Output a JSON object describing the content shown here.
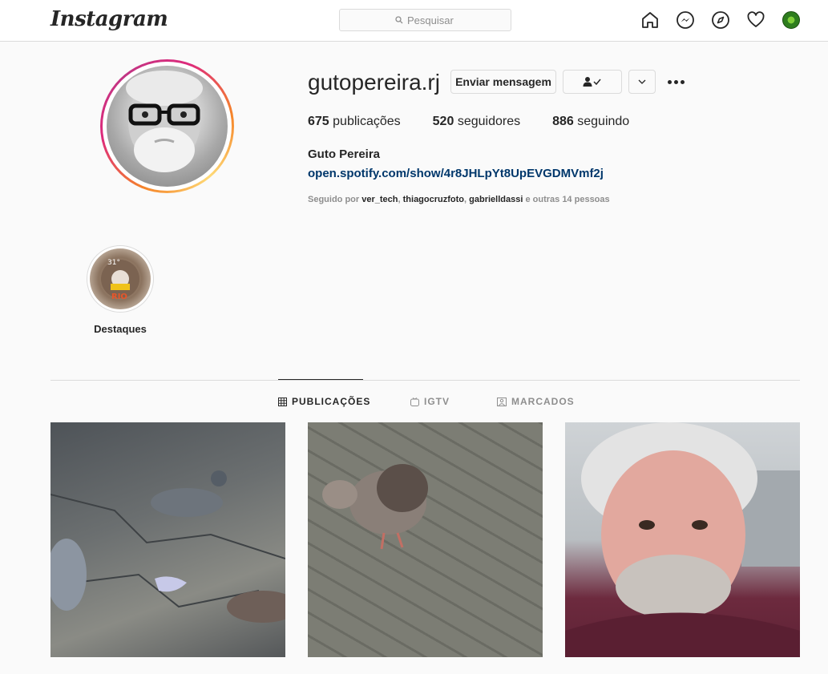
{
  "app": {
    "logo": "Instagram"
  },
  "search": {
    "placeholder": "Pesquisar"
  },
  "nav": {
    "icons": [
      "home-icon",
      "messenger-icon",
      "explore-icon",
      "heart-icon",
      "profile-avatar"
    ]
  },
  "profile": {
    "username": "gutopereira.rj",
    "buttons": {
      "message": "Enviar mensagem"
    },
    "stats": [
      {
        "count": "675",
        "label": "publicações"
      },
      {
        "count": "520",
        "label": "seguidores"
      },
      {
        "count": "886",
        "label": "seguindo"
      }
    ],
    "full_name": "Guto Pereira",
    "link": "open.spotify.com/show/4r8JHLpYt8UpEVGDMVmf2j",
    "followed_by": {
      "prefix": "Seguido por",
      "names": [
        "ver_tech",
        "thiagocruzfoto",
        "gabrielldassi"
      ],
      "suffix": "e outras 14 pessoas"
    }
  },
  "highlights": [
    {
      "label": "Destaques",
      "image_text_top": "31°",
      "image_text_bottom": "RIO"
    }
  ],
  "tabs": [
    {
      "label": "PUBLICAÇÕES",
      "active": true,
      "icon": "grid-icon"
    },
    {
      "label": "IGTV",
      "active": false,
      "icon": "igtv-icon"
    },
    {
      "label": "MARCADOS",
      "active": false,
      "icon": "tagged-icon"
    }
  ],
  "posts": [
    {
      "subject": "pigeons-on-pavement"
    },
    {
      "subject": "pigeon-on-bricks"
    },
    {
      "subject": "selfie-in-car"
    }
  ],
  "colors": {
    "link": "#00376b",
    "muted": "#8e8e8e",
    "border": "#dbdbdb",
    "text": "#262626"
  }
}
